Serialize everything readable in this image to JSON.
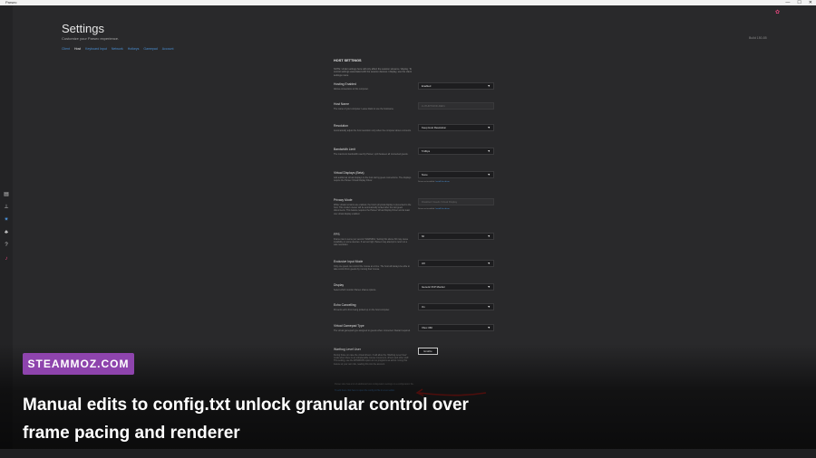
{
  "window": {
    "title": "Parsec",
    "controls": [
      "—",
      "☐",
      "✕"
    ]
  },
  "sidebar": {
    "icons": [
      "computer-icon",
      "network-icon",
      "gear-icon",
      "team-icon",
      "help-icon",
      "pink-logo-icon"
    ]
  },
  "header": {
    "title": "Settings",
    "subtitle": "Customize your Parsec experience.",
    "build": "Build 150-85",
    "tabs": [
      {
        "label": "Client",
        "active": false
      },
      {
        "label": "Host",
        "active": true
      },
      {
        "label": "Keyboard Input",
        "active": false
      },
      {
        "label": "Network",
        "active": false
      },
      {
        "label": "Hotkeys",
        "active": false
      },
      {
        "label": "Gamepad",
        "active": false
      },
      {
        "label": "Account",
        "active": false
      }
    ]
  },
  "panel": {
    "heading": "HOST SETTINGS",
    "note": "NOTE: Under settings here will only affect the session streams / display. To control settings associated with the session devices / display, use the client settings menu.",
    "rows": [
      {
        "label": "Hosting Enabled",
        "desc": "Allows connections to this computer.",
        "value": "Enabled",
        "dropdown": true,
        "placeholder": false,
        "help": ""
      },
      {
        "label": "Host Name",
        "desc": "The name of your computer. Leave blank to use the hostname.",
        "value": "LUXURYMOD-DE01",
        "dropdown": false,
        "placeholder": true,
        "help": ""
      },
      {
        "label": "Resolution",
        "desc": "Automatically adjust the host resolution only when the computer above connects.",
        "value": "Keep Host Resolution",
        "dropdown": true,
        "placeholder": false,
        "help": ""
      },
      {
        "label": "Bandwidth Limit",
        "desc": "The maximum bandwidth used by Parsec, split between all connected guests.",
        "value": "5 Mbps",
        "dropdown": true,
        "placeholder": false,
        "help": ""
      },
      {
        "label": "Virtual Displays (Beta)",
        "desc": "Add additional virtual displays to the host during guest connections. The displays require the Parsec Virtual Display Driver.",
        "value": "None",
        "dropdown": true,
        "placeholder": false,
        "help": "Driver not installed.",
        "help_link": "Install the driver"
      },
      {
        "label": "Privacy Mode",
        "desc": "While virtual monitors are enabled, the host's physical display is prevented to the host. This mode's viewer will be automatically locked after the last guest disconnects. This feature requires the Parsec Virtual Display Driver and at least one virtual display enabled.",
        "value": "Disabled: Needs Virtual Display",
        "dropdown": false,
        "placeholder": true,
        "help": "Driver not installed.",
        "help_link": "Install the driver"
      },
      {
        "label": "FPS",
        "desc": "Frame rate to serve per second. WARNING: Setting this above 60 may cause instability on some devices. If set too high, Parsec may attempt to return to a safe resolution.",
        "value": "60",
        "dropdown": true,
        "placeholder": false,
        "help": ""
      },
      {
        "label": "Exclusive Input Mode",
        "desc": "Only one guest can control the mouse at a time. The host will always be able to take control from guests by moving their mouse.",
        "value": "Off",
        "dropdown": true,
        "placeholder": false,
        "help": ""
      },
      {
        "label": "Display",
        "desc": "Select which monitor Parsec shares options.",
        "value": "Generic PnP Monitor",
        "dropdown": true,
        "placeholder": false,
        "help": ""
      },
      {
        "label": "Echo Cancelling",
        "desc": "Prevents echo from being picked up on the host computer.",
        "value": "On",
        "dropdown": true,
        "placeholder": false,
        "help": ""
      },
      {
        "label": "Virtual Gamepad Type",
        "desc": "The virtual gamepad type assigned to guests when connected. Restart required.",
        "value": "Xbox 360",
        "dropdown": true,
        "placeholder": false,
        "help": ""
      }
    ],
    "warzone": {
      "label": "Warthog Level User",
      "desc": "During those on case the virtual drivers. It will allow the 'Warthog Level User' mode when there is an unbelievable mouse movement, drivers and other stuff. This setting, use the WINDOWS option to run programs as admin. Using this feature at your own risk, reading this into the account.",
      "button": "Enable"
    },
    "footer_line1": "Parsec also has a lot of additional host configuration settings in a configuration file.",
    "footer_line2": "To edit them click here to open the config.txt file in a text editor."
  },
  "overlay": {
    "badge": "STEAMMOZ.COM",
    "caption": "Manual edits to config.txt unlock granular control over frame pacing and renderer"
  },
  "colors": {
    "accent": "#4a8fd4",
    "badge": "#8e44ad",
    "arrow": "#b3201b",
    "pink": "#e0457b"
  }
}
